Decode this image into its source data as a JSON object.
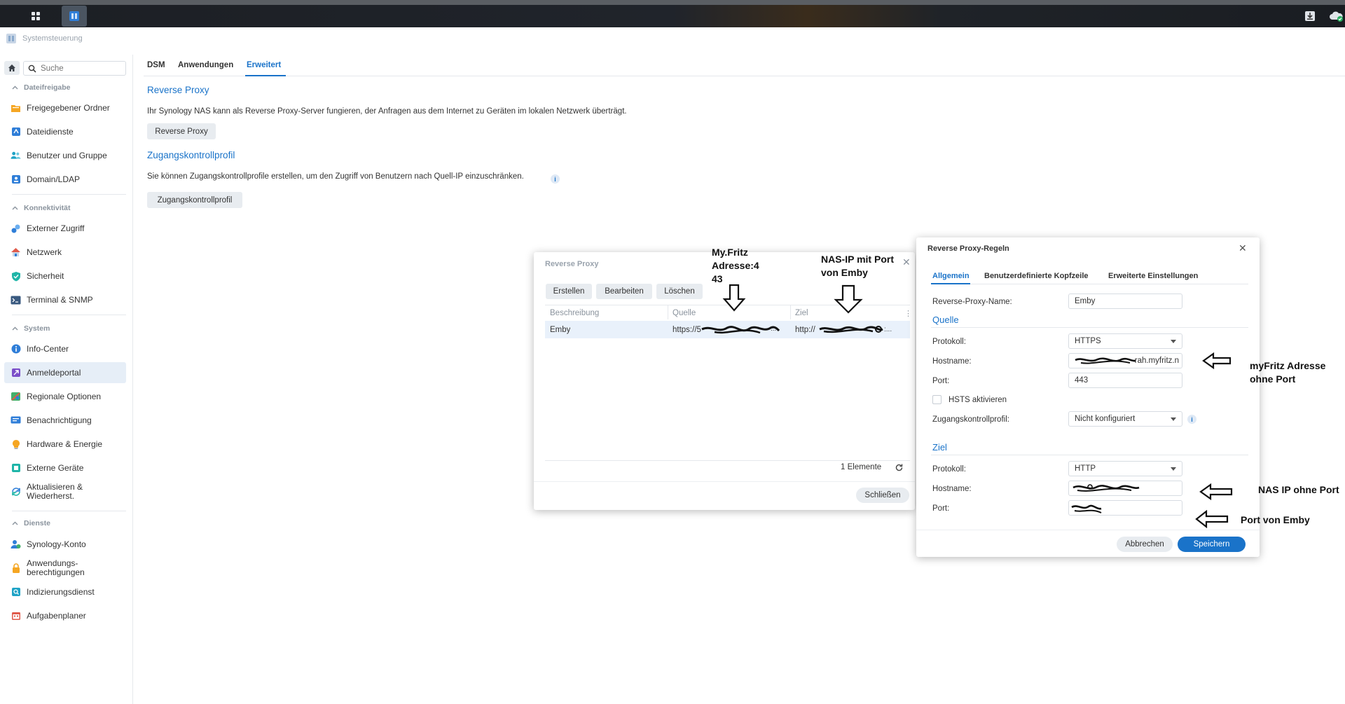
{
  "window": {
    "title": "Systemsteuerung"
  },
  "search": {
    "placeholder": "Suche"
  },
  "tabs": [
    {
      "label": "DSM"
    },
    {
      "label": "Anwendungen"
    },
    {
      "label": "Erweitert"
    }
  ],
  "sidebar": {
    "sections": [
      {
        "label": "Dateifreigabe"
      },
      {
        "label": "Konnektivität"
      },
      {
        "label": "System"
      },
      {
        "label": "Dienste"
      }
    ],
    "items": [
      {
        "label": "Freigegebener Ordner",
        "icon": "folder-icon"
      },
      {
        "label": "Dateidienste",
        "icon": "file-services-icon"
      },
      {
        "label": "Benutzer und Gruppe",
        "icon": "users-icon"
      },
      {
        "label": "Domain/LDAP",
        "icon": "domain-icon"
      },
      {
        "label": "Externer Zugriff",
        "icon": "external-access-icon"
      },
      {
        "label": "Netzwerk",
        "icon": "network-icon"
      },
      {
        "label": "Sicherheit",
        "icon": "shield-icon"
      },
      {
        "label": "Terminal & SNMP",
        "icon": "terminal-icon"
      },
      {
        "label": "Info-Center",
        "icon": "info-icon"
      },
      {
        "label": "Anmeldeportal",
        "icon": "login-portal-icon"
      },
      {
        "label": "Regionale Optionen",
        "icon": "regional-icon"
      },
      {
        "label": "Benachrichtigung",
        "icon": "notification-icon"
      },
      {
        "label": "Hardware & Energie",
        "icon": "hardware-icon"
      },
      {
        "label": "Externe Geräte",
        "icon": "external-devices-icon"
      },
      {
        "label": "Aktualisieren & Wiederherst.",
        "icon": "update-icon"
      },
      {
        "label": "Synology-Konto",
        "icon": "account-icon"
      },
      {
        "label": "Anwendungs-berechtigungen",
        "icon": "lock-icon"
      },
      {
        "label": "Indizierungsdienst",
        "icon": "index-icon"
      },
      {
        "label": "Aufgabenplaner",
        "icon": "calendar-icon"
      }
    ]
  },
  "main": {
    "reverse_proxy": {
      "heading": "Reverse Proxy",
      "text": "Ihr Synology NAS kann als Reverse Proxy-Server fungieren, der Anfragen aus dem Internet zu Geräten im lokalen Netzwerk überträgt.",
      "button": "Reverse Proxy"
    },
    "access_profile": {
      "heading": "Zugangskontrollprofil",
      "text": "Sie können Zugangskontrollprofile erstellen, um den Zugriff von Benutzern nach Quell-IP einzuschränken.",
      "button": "Zugangskontrollprofil"
    }
  },
  "list_dialog": {
    "title": "Reverse Proxy",
    "buttons": {
      "create": "Erstellen",
      "edit": "Bearbeiten",
      "delete": "Löschen"
    },
    "columns": [
      "Beschreibung",
      "Quelle",
      "Ziel"
    ],
    "rows": [
      {
        "description": "Emby",
        "source": "https://5",
        "target": "http://"
      }
    ],
    "count": "1 Elemente",
    "close": "Schließen"
  },
  "rules_dialog": {
    "title": "Reverse Proxy-Regeln",
    "tabs": [
      "Allgemein",
      "Benutzerdefinierte Kopfzeile",
      "Erweiterte Einstellungen"
    ],
    "name_label": "Reverse-Proxy-Name:",
    "name_value": "Emby",
    "source_heading": "Quelle",
    "target_heading": "Ziel",
    "protocol_label": "Protokoll:",
    "hostname_label": "Hostname:",
    "port_label": "Port:",
    "source": {
      "protocol": "HTTPS",
      "hostname_suffix": "rah.myfritz.n",
      "port": "443"
    },
    "hsts_label": "HSTS aktivieren",
    "access_label": "Zugangskontrollprofil:",
    "access_value": "Nicht konfiguriert",
    "target": {
      "protocol": "HTTP",
      "hostname": "",
      "port": ""
    },
    "cancel": "Abbrechen",
    "save": "Speichern"
  },
  "annotations": {
    "myfritz_port_1": "My.Fritz",
    "myfritz_port_2": "Adresse:4",
    "myfritz_port_3": "43",
    "nas_ip_1": "NAS-IP mit Port",
    "nas_ip_2": "von Emby",
    "myfritz_host_1": "myFritz Adresse",
    "myfritz_host_2": "ohne Port",
    "nas_host": "NAS IP ohne Port",
    "port_emby": "Port von Emby"
  },
  "colors": {
    "accent": "#1a73c9",
    "taskbar": "#1f2328"
  }
}
